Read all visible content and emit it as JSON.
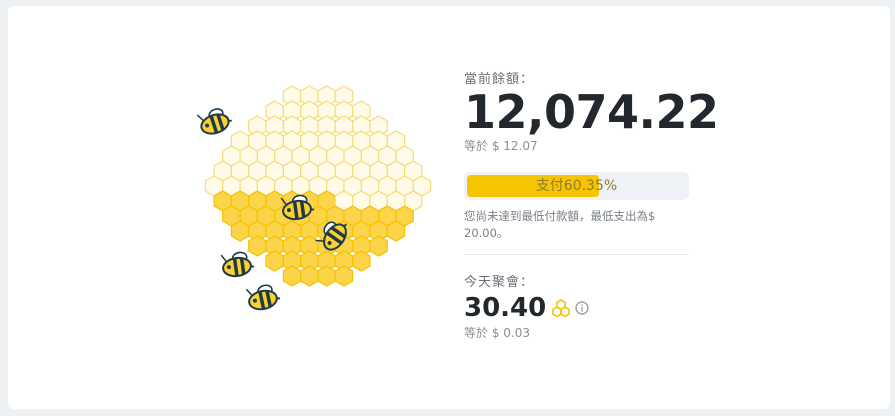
{
  "balance": {
    "label": "當前餘額：",
    "amount": "12,074.22",
    "equivalent": "等於 $ 12.07"
  },
  "payout": {
    "progress_text": "支付60.35%",
    "progress_value": 0.6035,
    "note": "您尚未達到最低付款額，最低支出為$ 20.00。"
  },
  "today": {
    "label": "今天聚會：",
    "amount": "30.40",
    "equivalent": "等於 $ 0.03"
  },
  "icons": {
    "coin": "honeycomb-coin-icon",
    "info": "info-icon"
  },
  "colors": {
    "accent": "#f7c500",
    "honey": "#fbd44a",
    "comb_outline": "#f5dc7a",
    "bee_dark": "#1e3b47"
  }
}
